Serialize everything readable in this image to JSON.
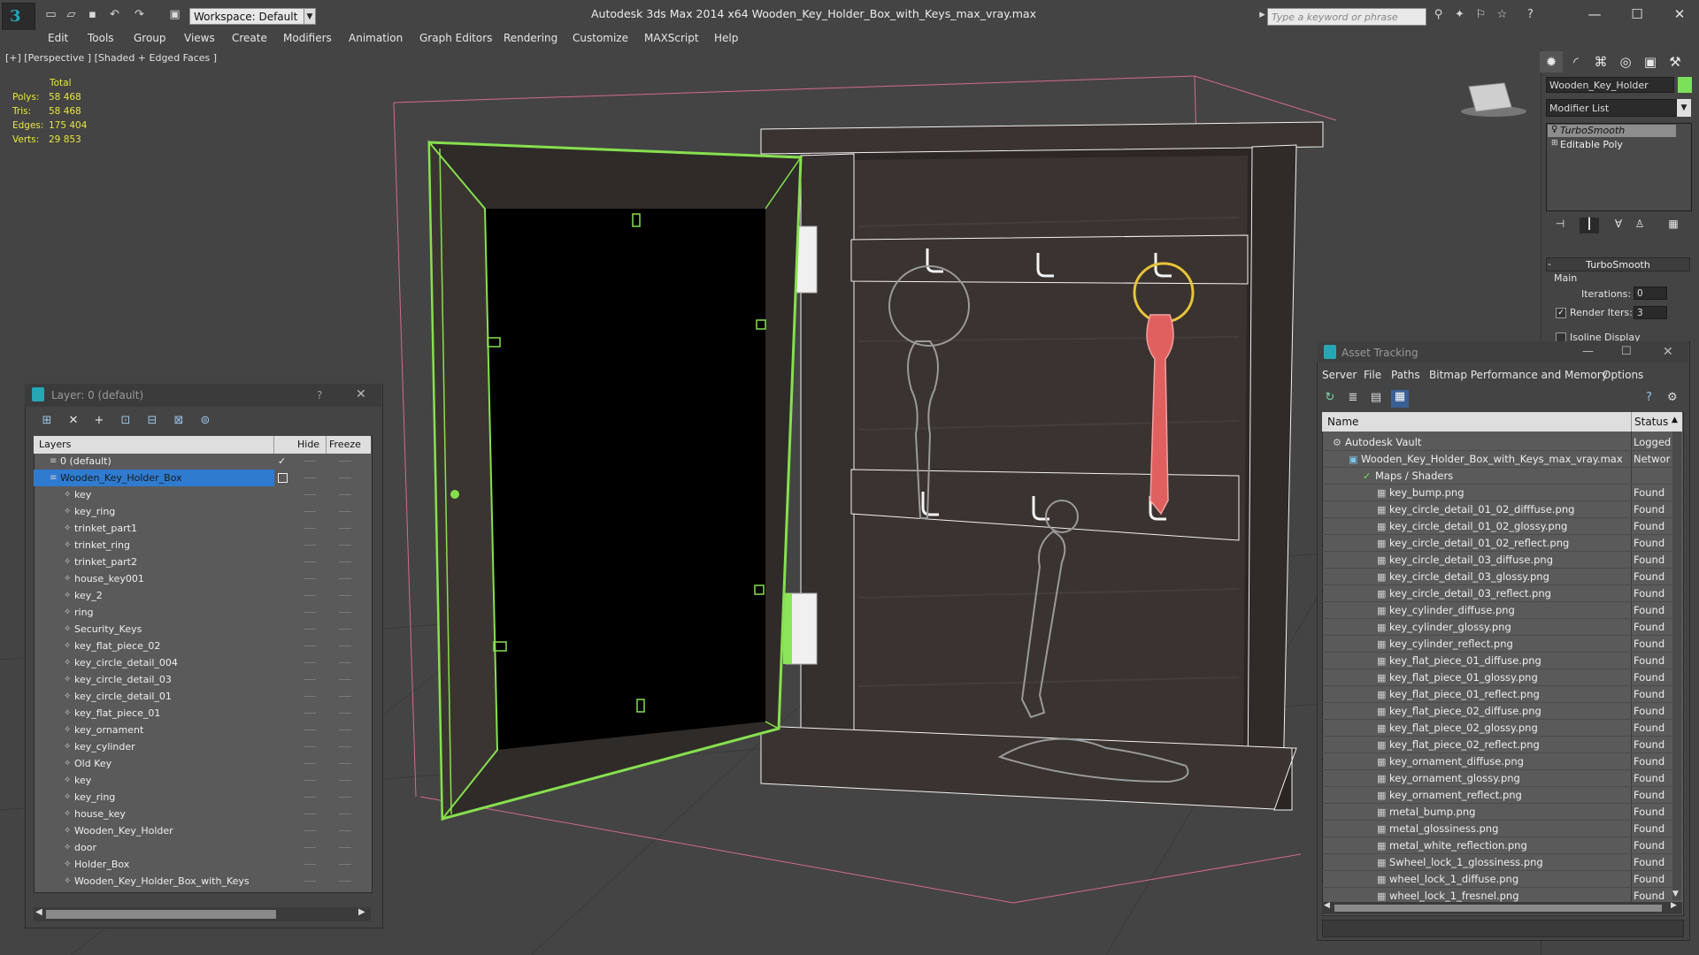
{
  "titlebar": {
    "app_title": "Autodesk 3ds Max  2014 x64      Wooden_Key_Holder_Box_with_Keys_max_vray.max",
    "workspace": "Workspace: Default",
    "search_placeholder": "Type a keyword or phrase",
    "app_logo": "3"
  },
  "menu": [
    "Edit",
    "Tools",
    "Group",
    "Views",
    "Create",
    "Modifiers",
    "Animation",
    "Graph Editors",
    "Rendering",
    "Customize",
    "MAXScript",
    "Help"
  ],
  "viewport": {
    "label": "[+] [Perspective ] [Shaded + Edged Faces ]",
    "stats": {
      "total_label": "Total",
      "polys_label": "Polys:",
      "polys": "58 468",
      "tris_label": "Tris:",
      "tris": "58 468",
      "edges_label": "Edges:",
      "edges": "175 404",
      "verts_label": "Verts:",
      "verts": "29 853"
    }
  },
  "command_panel": {
    "object_name": "Wooden_Key_Holder",
    "object_color": "#7be05a",
    "modifier_list": "Modifier List",
    "stack": [
      "TurboSmooth",
      "Editable Poly"
    ],
    "rollout_title": "TurboSmooth",
    "main_label": "Main",
    "iterations_label": "Iterations:",
    "iterations": "0",
    "render_iters_label": "Render Iters:",
    "render_iters": "3",
    "isoline_label": "Isoline Display"
  },
  "layer_panel": {
    "title": "Layer: 0 (default)",
    "help": "?",
    "columns": {
      "layers": "Layers",
      "hide": "Hide",
      "freeze": "Freeze"
    },
    "rows": [
      {
        "label": "0 (default)",
        "level": 0
      },
      {
        "label": "Wooden_Key_Holder_Box",
        "level": 0,
        "selected": true
      },
      {
        "label": "key",
        "level": 1
      },
      {
        "label": "key_ring",
        "level": 1
      },
      {
        "label": "trinket_part1",
        "level": 1
      },
      {
        "label": "trinket_ring",
        "level": 1
      },
      {
        "label": "trinket_part2",
        "level": 1
      },
      {
        "label": "house_key001",
        "level": 1
      },
      {
        "label": "key_2",
        "level": 1
      },
      {
        "label": "ring",
        "level": 1
      },
      {
        "label": "Security_Keys",
        "level": 1
      },
      {
        "label": "key_flat_piece_02",
        "level": 1
      },
      {
        "label": "key_circle_detail_004",
        "level": 1
      },
      {
        "label": "key_circle_detail_03",
        "level": 1
      },
      {
        "label": "key_circle_detail_01",
        "level": 1
      },
      {
        "label": "key_flat_piece_01",
        "level": 1
      },
      {
        "label": "key_ornament",
        "level": 1
      },
      {
        "label": "key_cylinder",
        "level": 1
      },
      {
        "label": "Old Key",
        "level": 1
      },
      {
        "label": "key",
        "level": 1
      },
      {
        "label": "key_ring",
        "level": 1
      },
      {
        "label": "house_key",
        "level": 1
      },
      {
        "label": "Wooden_Key_Holder",
        "level": 1
      },
      {
        "label": "door",
        "level": 1
      },
      {
        "label": "Holder_Box",
        "level": 1
      },
      {
        "label": "Wooden_Key_Holder_Box_with_Keys",
        "level": 1
      }
    ]
  },
  "asset_panel": {
    "title": "Asset Tracking",
    "menu": [
      "Server",
      "File",
      "Paths",
      "Bitmap Performance and Memory",
      "Options"
    ],
    "columns": {
      "name": "Name",
      "status": "Status"
    },
    "rows": [
      {
        "name": "Autodesk Vault",
        "status": "Logged",
        "level": 0
      },
      {
        "name": "Wooden_Key_Holder_Box_with_Keys_max_vray.max",
        "status": "Networ",
        "level": 1
      },
      {
        "name": "Maps / Shaders",
        "status": "",
        "level": 2
      },
      {
        "name": "key_bump.png",
        "status": "Found",
        "level": 3
      },
      {
        "name": "key_circle_detail_01_02_difffuse.png",
        "status": "Found",
        "level": 3
      },
      {
        "name": "key_circle_detail_01_02_glossy.png",
        "status": "Found",
        "level": 3
      },
      {
        "name": "key_circle_detail_01_02_reflect.png",
        "status": "Found",
        "level": 3
      },
      {
        "name": "key_circle_detail_03_diffuse.png",
        "status": "Found",
        "level": 3
      },
      {
        "name": "key_circle_detail_03_glossy.png",
        "status": "Found",
        "level": 3
      },
      {
        "name": "key_circle_detail_03_reflect.png",
        "status": "Found",
        "level": 3
      },
      {
        "name": "key_cylinder_diffuse.png",
        "status": "Found",
        "level": 3
      },
      {
        "name": "key_cylinder_glossy.png",
        "status": "Found",
        "level": 3
      },
      {
        "name": "key_cylinder_reflect.png",
        "status": "Found",
        "level": 3
      },
      {
        "name": "key_flat_piece_01_diffuse.png",
        "status": "Found",
        "level": 3
      },
      {
        "name": "key_flat_piece_01_glossy.png",
        "status": "Found",
        "level": 3
      },
      {
        "name": "key_flat_piece_01_reflect.png",
        "status": "Found",
        "level": 3
      },
      {
        "name": "key_flat_piece_02_diffuse.png",
        "status": "Found",
        "level": 3
      },
      {
        "name": "key_flat_piece_02_glossy.png",
        "status": "Found",
        "level": 3
      },
      {
        "name": "key_flat_piece_02_reflect.png",
        "status": "Found",
        "level": 3
      },
      {
        "name": "key_ornament_diffuse.png",
        "status": "Found",
        "level": 3
      },
      {
        "name": "key_ornament_glossy.png",
        "status": "Found",
        "level": 3
      },
      {
        "name": "key_ornament_reflect.png",
        "status": "Found",
        "level": 3
      },
      {
        "name": "metal_bump.png",
        "status": "Found",
        "level": 3
      },
      {
        "name": "metal_glossiness.png",
        "status": "Found",
        "level": 3
      },
      {
        "name": "metal_white_reflection.png",
        "status": "Found",
        "level": 3
      },
      {
        "name": "Swheel_lock_1_glossiness.png",
        "status": "Found",
        "level": 3
      },
      {
        "name": "wheel_lock_1_diffuse.png",
        "status": "Found",
        "level": 3
      },
      {
        "name": "wheel_lock_1_fresnel.png",
        "status": "Found",
        "level": 3
      }
    ]
  }
}
